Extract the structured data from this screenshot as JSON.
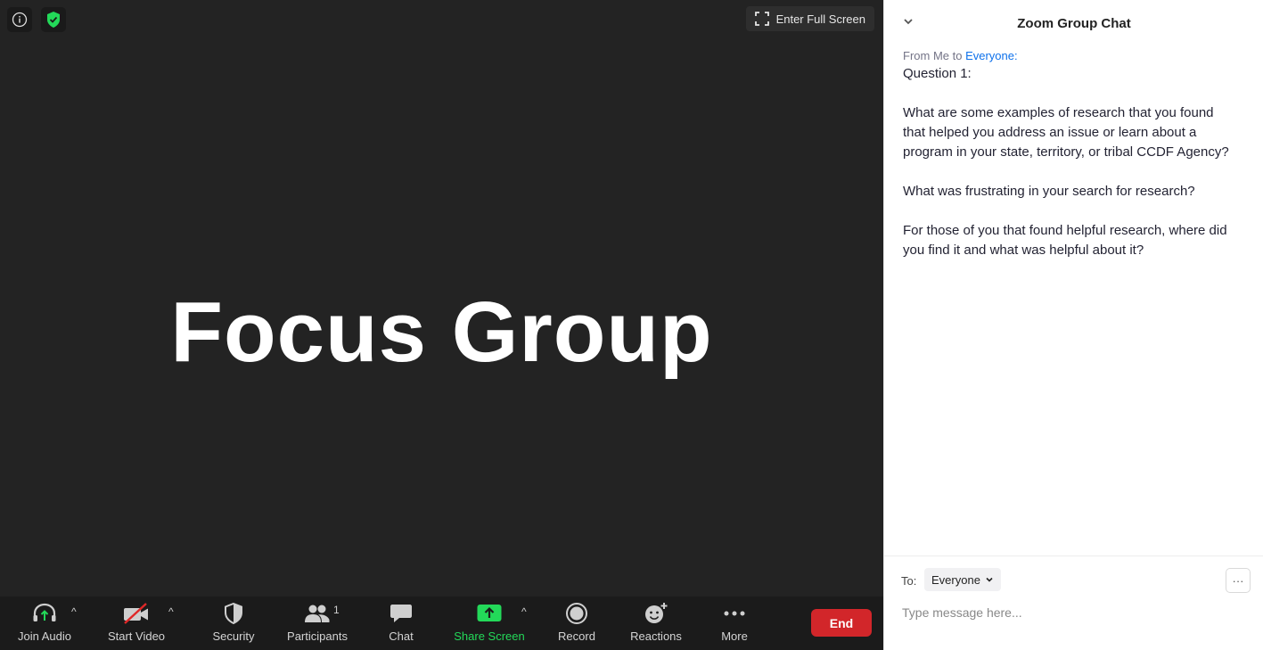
{
  "meeting": {
    "fullscreen_label": "Enter Full Screen",
    "shared_content_title": "Focus Group"
  },
  "toolbar": {
    "join_audio": "Join Audio",
    "start_video": "Start Video",
    "security": "Security",
    "participants": "Participants",
    "participant_count": "1",
    "chat": "Chat",
    "share_screen": "Share Screen",
    "record": "Record",
    "reactions": "Reactions",
    "more": "More",
    "end": "End",
    "share_color": "#23d959",
    "end_color": "#d2262a"
  },
  "chat": {
    "title": "Zoom Group Chat",
    "messages": [
      {
        "from_prefix": "From Me to ",
        "to": "Everyone:",
        "body": "Question 1:\n\nWhat are some examples of research that you found that helped you address an issue or learn about a program in your state, territory, or tribal CCDF Agency?\n\nWhat was frustrating in your search for research?\n\nFor those of you that found helpful research, where did you find it and what was helpful about it?"
      }
    ],
    "to_label": "To:",
    "recipient": "Everyone",
    "more_label": "···",
    "placeholder": "Type message here..."
  }
}
